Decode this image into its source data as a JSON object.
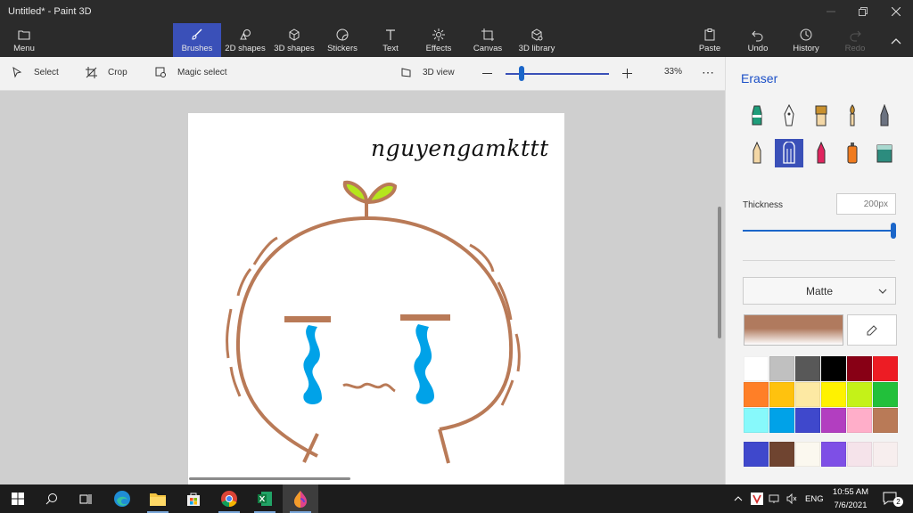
{
  "window": {
    "title": "Untitled* - Paint 3D"
  },
  "ribbon": {
    "menu": "Menu",
    "brushes": "Brushes",
    "shapes2d": "2D shapes",
    "shapes3d": "3D shapes",
    "stickers": "Stickers",
    "text": "Text",
    "effects": "Effects",
    "canvas": "Canvas",
    "library": "3D library",
    "paste": "Paste",
    "undo": "Undo",
    "history": "History",
    "redo": "Redo",
    "active_tab": "Brushes"
  },
  "toolbar": {
    "select": "Select",
    "crop": "Crop",
    "magic_select": "Magic select",
    "view3d": "3D view",
    "zoom_level": "33%"
  },
  "canvas": {
    "text": "nguyengamkttt"
  },
  "panel": {
    "title": "Eraser",
    "thickness_label": "Thickness",
    "thickness_value": "200px",
    "thickness_fraction": 1.0,
    "finish": "Matte",
    "current_color": "#b07a5e"
  },
  "palette": [
    "#ffffff",
    "#c0c0c0",
    "#585858",
    "#000000",
    "#880015",
    "#ed1c24",
    "#ff7f27",
    "#ffc20e",
    "#fde9a3",
    "#fff200",
    "#c4f218",
    "#22c03b",
    "#87f9fb",
    "#00a2e8",
    "#3f48cc",
    "#b23ec0",
    "#ffaec9",
    "#b97a57"
  ],
  "custom_colors": [
    "#3f48cc",
    "#6f4430",
    "#fbf8ef",
    "#7e4fe6",
    "#f5e3ea",
    "#f7eeee"
  ],
  "taskbar": {
    "lang": "ENG",
    "time": "10:55 AM",
    "date": "7/6/2021",
    "notifications": "2"
  }
}
